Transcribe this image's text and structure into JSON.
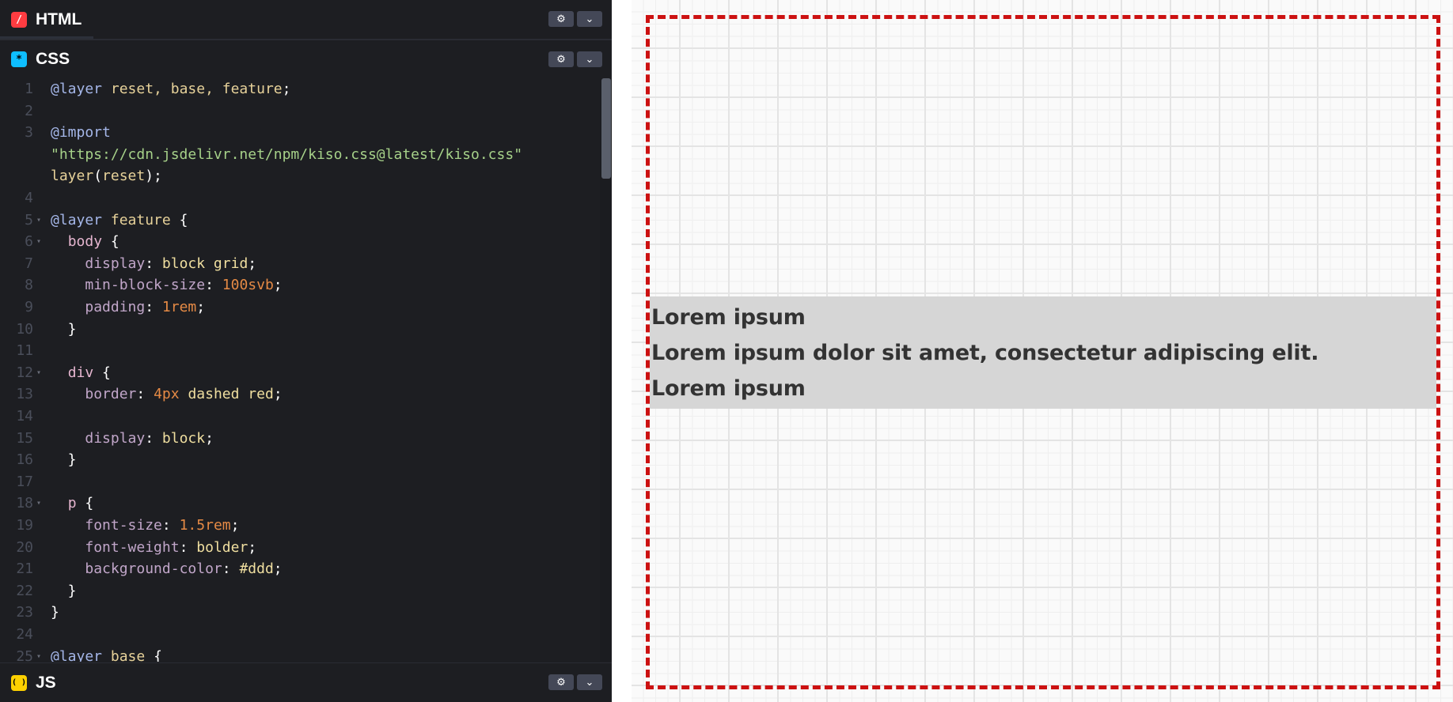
{
  "html_panel": {
    "title": "HTML",
    "icon": "/",
    "gear": "⚙",
    "chevron": "⌄"
  },
  "css_panel": {
    "title": "CSS",
    "icon": "*",
    "gear": "⚙",
    "chevron": "⌄",
    "lines": [
      {
        "n": "1",
        "fold": "",
        "tokens": [
          [
            "at",
            "@layer"
          ],
          [
            "pun",
            " "
          ],
          [
            "name",
            "reset, base, feature"
          ],
          [
            "pun",
            ";"
          ]
        ]
      },
      {
        "n": "2",
        "fold": "",
        "tokens": []
      },
      {
        "n": "3",
        "fold": "",
        "tokens": [
          [
            "at",
            "@import"
          ]
        ]
      },
      {
        "n": "",
        "fold": "",
        "tokens": [
          [
            "str",
            "\"https://cdn.jsdelivr.net/npm/kiso.css@latest/kiso.css\""
          ]
        ]
      },
      {
        "n": "",
        "fold": "",
        "tokens": [
          [
            "name",
            "layer"
          ],
          [
            "pun",
            "("
          ],
          [
            "name",
            "reset"
          ],
          [
            "pun",
            ");"
          ]
        ]
      },
      {
        "n": "4",
        "fold": "",
        "tokens": []
      },
      {
        "n": "5",
        "fold": "▾",
        "tokens": [
          [
            "at",
            "@layer"
          ],
          [
            "pun",
            " "
          ],
          [
            "name",
            "feature"
          ],
          [
            "pun",
            " {"
          ]
        ]
      },
      {
        "n": "6",
        "fold": "▾",
        "tokens": [
          [
            "pun",
            "  "
          ],
          [
            "sel",
            "body"
          ],
          [
            "pun",
            " {"
          ]
        ]
      },
      {
        "n": "7",
        "fold": "",
        "tokens": [
          [
            "pun",
            "    "
          ],
          [
            "prop",
            "display"
          ],
          [
            "pun",
            ": "
          ],
          [
            "val",
            "block grid"
          ],
          [
            "pun",
            ";"
          ]
        ]
      },
      {
        "n": "8",
        "fold": "",
        "tokens": [
          [
            "pun",
            "    "
          ],
          [
            "prop",
            "min-block-size"
          ],
          [
            "pun",
            ": "
          ],
          [
            "num",
            "100svb"
          ],
          [
            "pun",
            ";"
          ]
        ]
      },
      {
        "n": "9",
        "fold": "",
        "tokens": [
          [
            "pun",
            "    "
          ],
          [
            "prop",
            "padding"
          ],
          [
            "pun",
            ": "
          ],
          [
            "num",
            "1rem"
          ],
          [
            "pun",
            ";"
          ]
        ]
      },
      {
        "n": "10",
        "fold": "",
        "tokens": [
          [
            "pun",
            "  }"
          ]
        ]
      },
      {
        "n": "11",
        "fold": "",
        "tokens": []
      },
      {
        "n": "12",
        "fold": "▾",
        "tokens": [
          [
            "pun",
            "  "
          ],
          [
            "sel",
            "div"
          ],
          [
            "pun",
            " {"
          ]
        ]
      },
      {
        "n": "13",
        "fold": "",
        "tokens": [
          [
            "pun",
            "    "
          ],
          [
            "prop",
            "border"
          ],
          [
            "pun",
            ": "
          ],
          [
            "num",
            "4px"
          ],
          [
            "pun",
            " "
          ],
          [
            "val",
            "dashed red"
          ],
          [
            "pun",
            ";"
          ]
        ]
      },
      {
        "n": "14",
        "fold": "",
        "tokens": []
      },
      {
        "n": "15",
        "fold": "",
        "tokens": [
          [
            "pun",
            "    "
          ],
          [
            "prop",
            "display"
          ],
          [
            "pun",
            ": "
          ],
          [
            "val",
            "block"
          ],
          [
            "pun",
            ";"
          ]
        ]
      },
      {
        "n": "16",
        "fold": "",
        "tokens": [
          [
            "pun",
            "  }"
          ]
        ]
      },
      {
        "n": "17",
        "fold": "",
        "tokens": []
      },
      {
        "n": "18",
        "fold": "▾",
        "tokens": [
          [
            "pun",
            "  "
          ],
          [
            "sel",
            "p"
          ],
          [
            "pun",
            " {"
          ]
        ]
      },
      {
        "n": "19",
        "fold": "",
        "tokens": [
          [
            "pun",
            "    "
          ],
          [
            "prop",
            "font-size"
          ],
          [
            "pun",
            ": "
          ],
          [
            "num",
            "1.5rem"
          ],
          [
            "pun",
            ";"
          ]
        ]
      },
      {
        "n": "20",
        "fold": "",
        "tokens": [
          [
            "pun",
            "    "
          ],
          [
            "prop",
            "font-weight"
          ],
          [
            "pun",
            ": "
          ],
          [
            "val",
            "bolder"
          ],
          [
            "pun",
            ";"
          ]
        ]
      },
      {
        "n": "21",
        "fold": "",
        "tokens": [
          [
            "pun",
            "    "
          ],
          [
            "prop",
            "background-color"
          ],
          [
            "pun",
            ": "
          ],
          [
            "val",
            "#ddd"
          ],
          [
            "pun",
            ";"
          ]
        ]
      },
      {
        "n": "22",
        "fold": "",
        "tokens": [
          [
            "pun",
            "  }"
          ]
        ]
      },
      {
        "n": "23",
        "fold": "",
        "tokens": [
          [
            "pun",
            "}"
          ]
        ]
      },
      {
        "n": "24",
        "fold": "",
        "tokens": []
      },
      {
        "n": "25",
        "fold": "▾",
        "tokens": [
          [
            "at",
            "@layer"
          ],
          [
            "pun",
            " "
          ],
          [
            "name",
            "base"
          ],
          [
            "pun",
            " {"
          ]
        ]
      }
    ]
  },
  "js_panel": {
    "title": "JS",
    "icon": "( )",
    "gear": "⚙",
    "chevron": "⌄"
  },
  "preview": {
    "lines": [
      "Lorem ipsum",
      "Lorem ipsum dolor sit amet, consectetur adipiscing elit.",
      "Lorem ipsum"
    ]
  },
  "colors": {
    "html_badge": "#ff3c41",
    "css_badge": "#0ebeff",
    "js_badge": "#fcd000",
    "dashed_border": "#cc1111",
    "paragraph_bg": "#dddddd"
  }
}
